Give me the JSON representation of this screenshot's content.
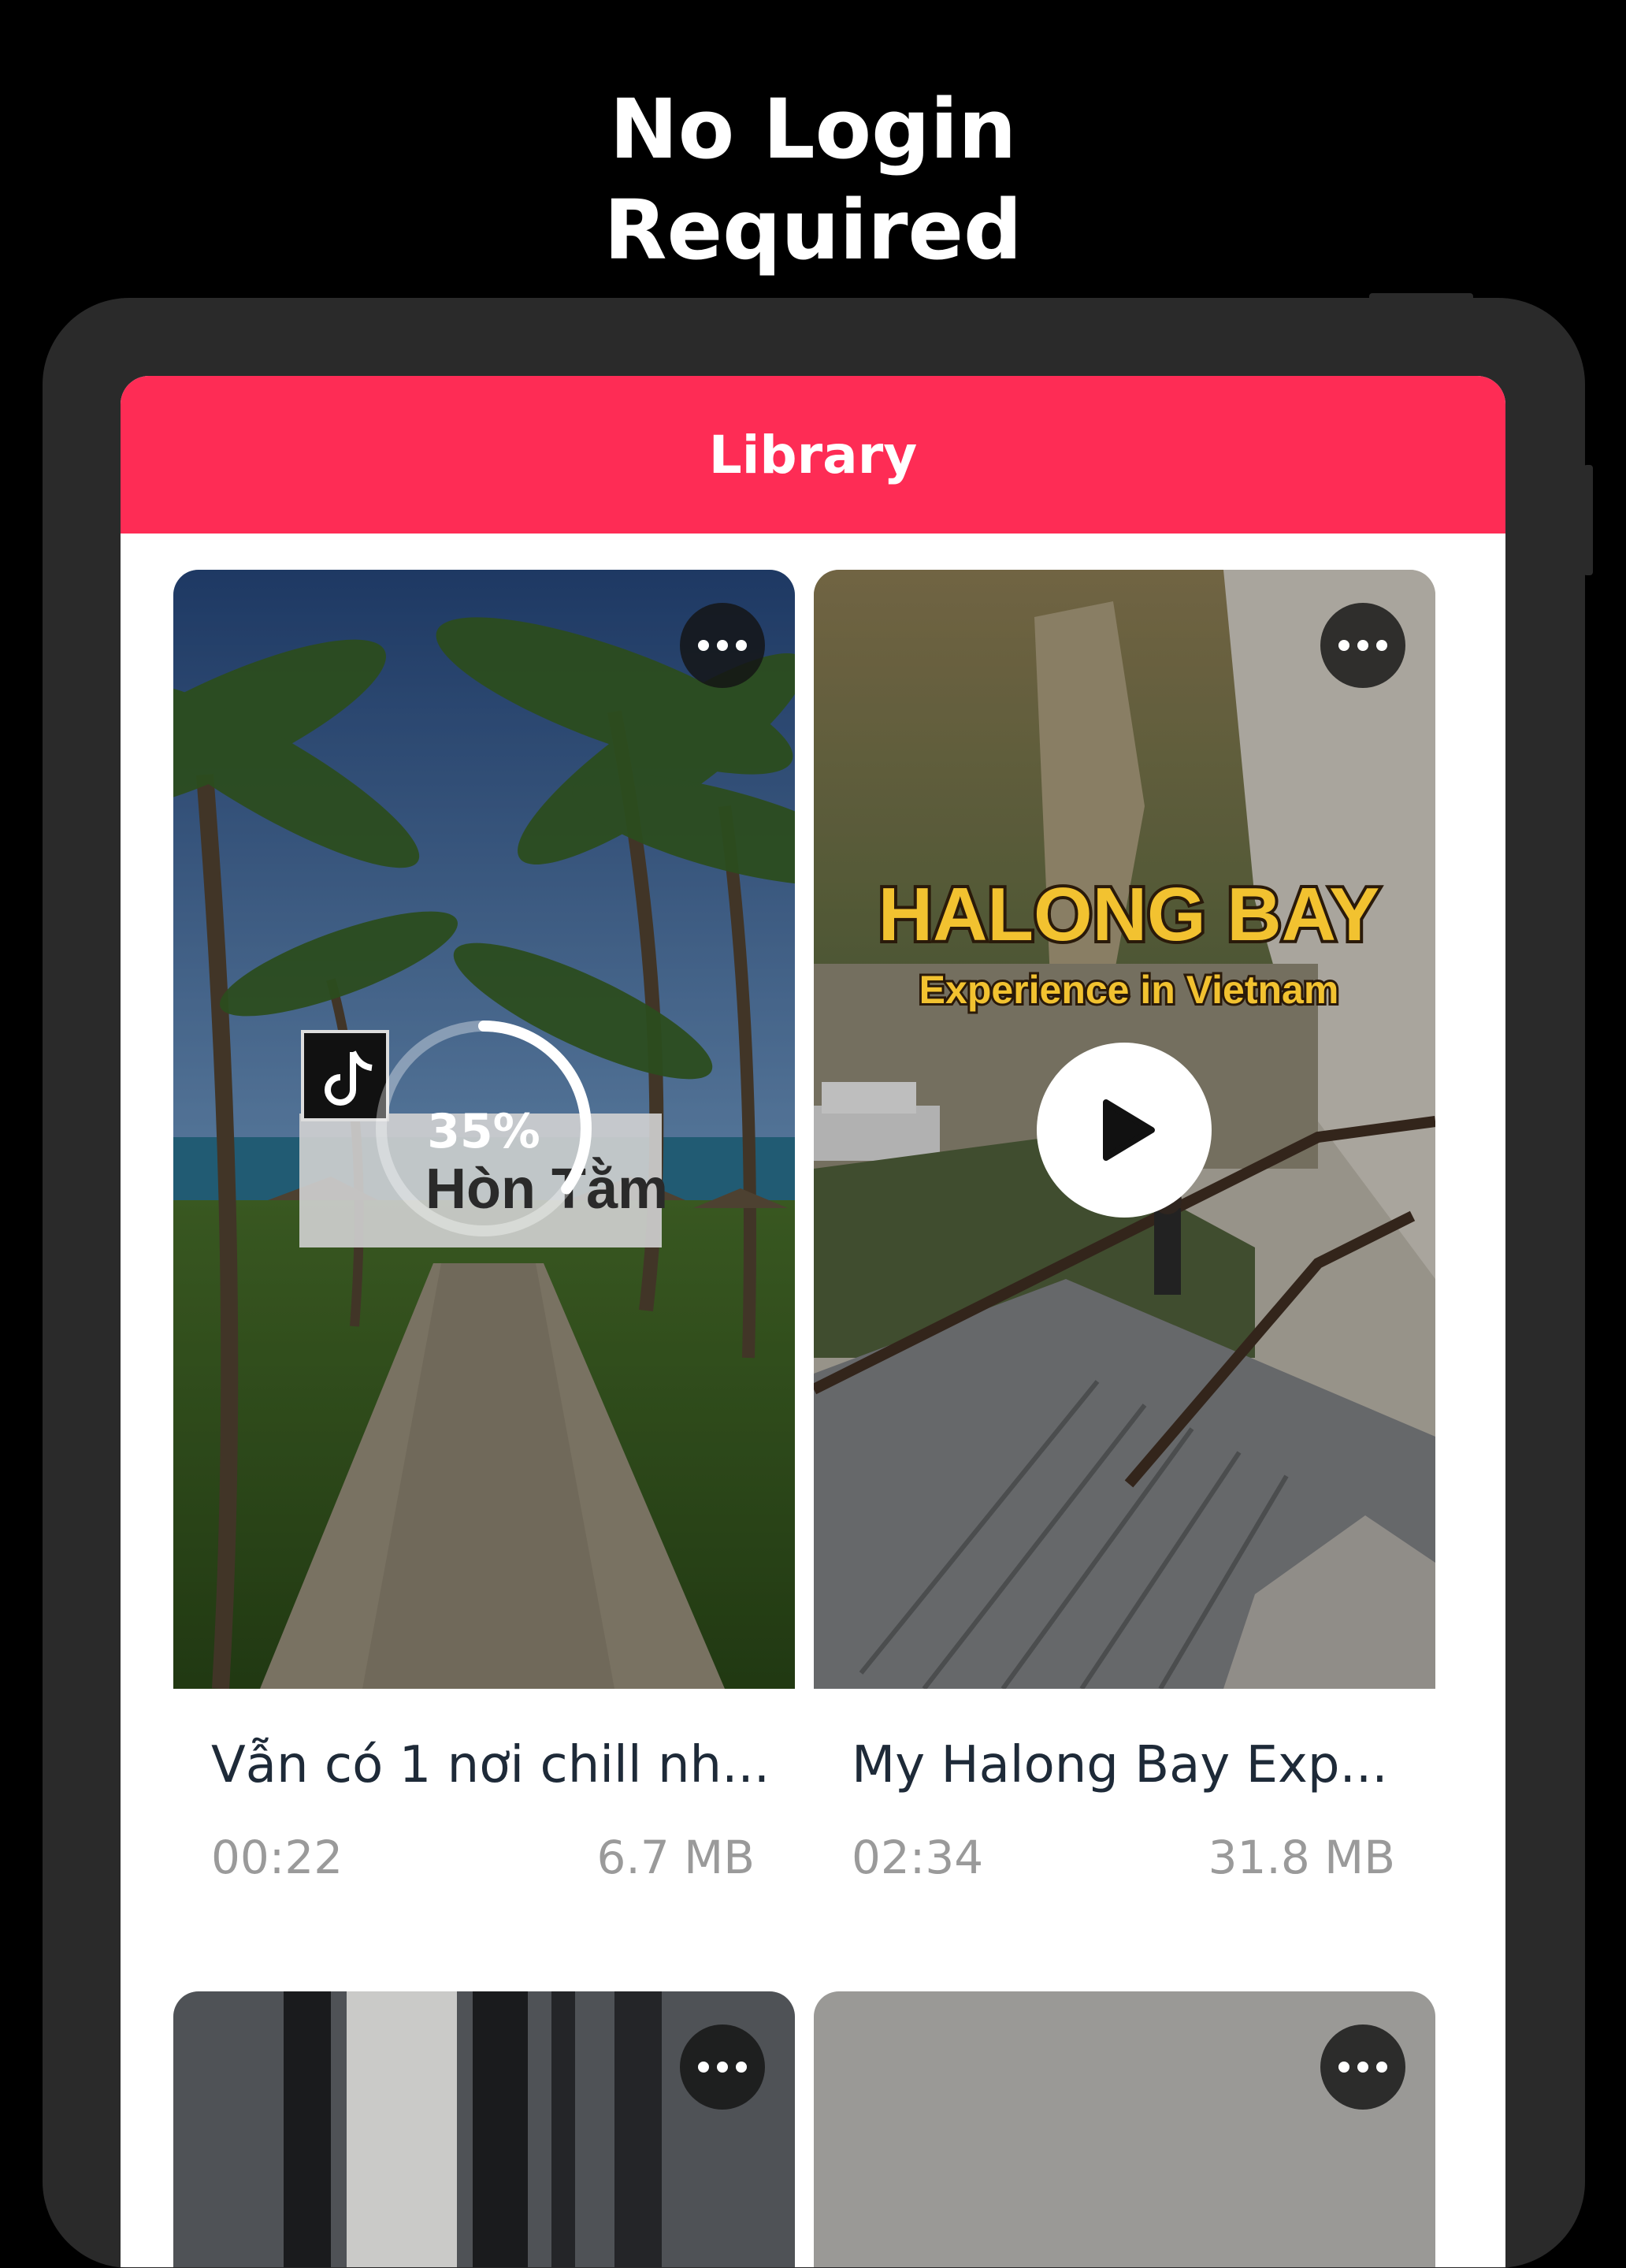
{
  "headline": {
    "line1": "No Login",
    "line2": "Required"
  },
  "navbar": {
    "title": "Library"
  },
  "colors": {
    "accent": "#fe2c55",
    "background": "#000000",
    "bezel": "#2a2a2a",
    "title_text": "#1e2a38",
    "meta_text": "#9a9a9a"
  },
  "videos": [
    {
      "title": "Vẫn có 1 nơi chill nh...",
      "duration": "00:22",
      "size": "6.7 MB",
      "progress_label": "35%",
      "progress": 0.35,
      "overlay_caption": "Hòn Tằm",
      "status": "downloading",
      "more_icon": "ellipsis-icon",
      "badge_icon": "tiktok-icon"
    },
    {
      "title": "My Halong Bay Exp...",
      "duration": "02:34",
      "size": "31.8 MB",
      "overlay_title": "HALONG BAY",
      "overlay_subtitle": "Experience in Vietnam",
      "status": "ready",
      "more_icon": "ellipsis-icon",
      "play_icon": "play-icon"
    },
    {
      "more_icon": "ellipsis-icon"
    },
    {
      "more_icon": "ellipsis-icon"
    }
  ]
}
